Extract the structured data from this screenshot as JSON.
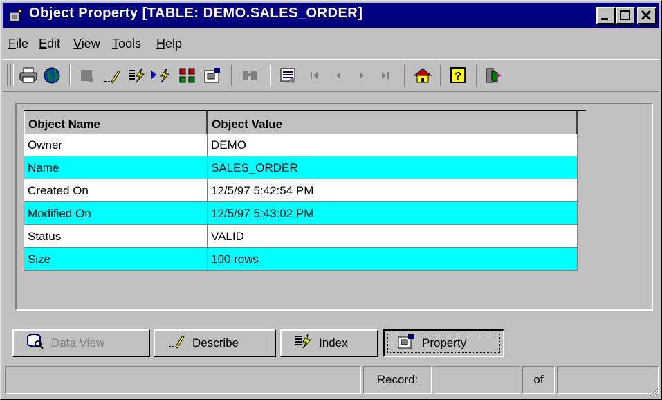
{
  "window": {
    "title": "Object Property  [TABLE:  DEMO.SALES_ORDER]",
    "min_label": "_",
    "max_label": "□",
    "close_label": "✕"
  },
  "menu": [
    {
      "label": "File",
      "accel": "F"
    },
    {
      "label": "Edit",
      "accel": "E"
    },
    {
      "label": "View",
      "accel": "V"
    },
    {
      "label": "Tools",
      "accel": "T"
    },
    {
      "label": "Help",
      "accel": "H"
    }
  ],
  "toolbar": {
    "icons": [
      "printer-icon",
      "globe-icon",
      "query-icon",
      "describe-icon",
      "index-icon",
      "run-icon",
      "relations-icon",
      "properties-icon",
      "find-icon",
      "record-view-icon",
      "first-record-icon",
      "previous-record-icon",
      "next-record-icon",
      "last-record-icon",
      "home-icon",
      "help-icon",
      "exit-icon"
    ]
  },
  "grid": {
    "headers": [
      "Object Name",
      "Object Value"
    ],
    "rows": [
      {
        "name": "Owner",
        "value": "DEMO"
      },
      {
        "name": "Name",
        "value": "SALES_ORDER"
      },
      {
        "name": "Created On",
        "value": "12/5/97 5:42:54 PM"
      },
      {
        "name": "Modified On",
        "value": "12/5/97 5:43:02 PM"
      },
      {
        "name": "Status",
        "value": "VALID"
      },
      {
        "name": "Size",
        "value": "100 rows"
      }
    ],
    "highlight_color": "#00ffff"
  },
  "tabs": [
    {
      "label": "Data View",
      "state": "disabled"
    },
    {
      "label": "Describe",
      "state": "normal"
    },
    {
      "label": "Index",
      "state": "normal"
    },
    {
      "label": "Property",
      "state": "active"
    }
  ],
  "status": {
    "message": "",
    "record_label": "Record:",
    "record_value": "",
    "of_label": "of",
    "total_value": ""
  },
  "colors": {
    "title_bar": "#000080",
    "face": "#c0c0c0",
    "cyan": "#00ffff"
  }
}
